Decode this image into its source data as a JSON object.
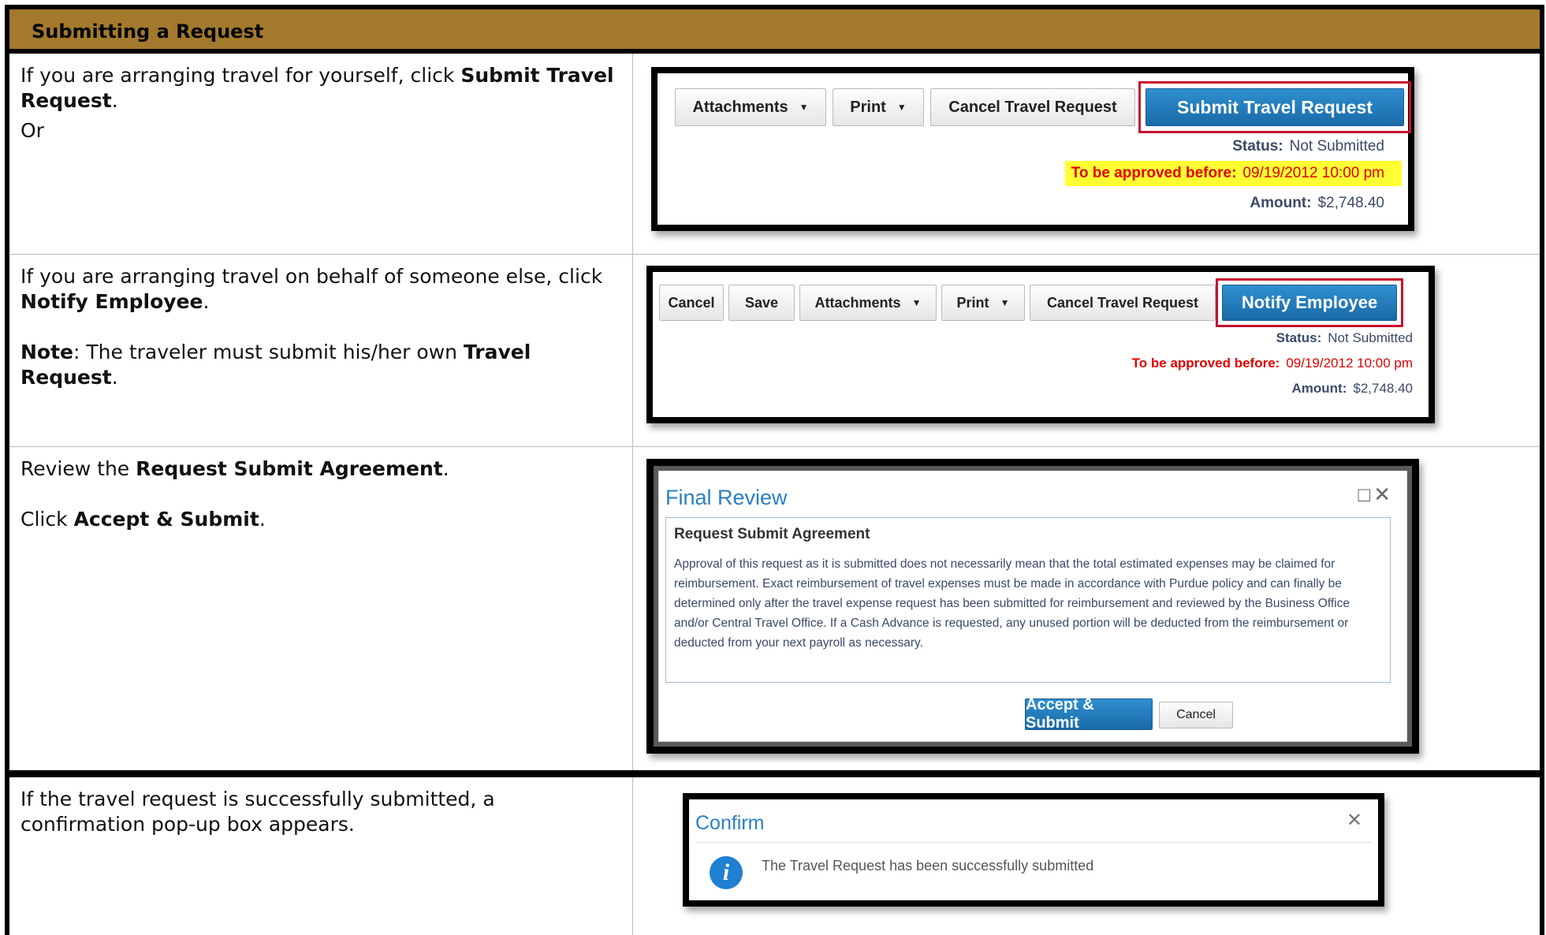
{
  "header": {
    "title": "Submitting a Request"
  },
  "rows": [
    {
      "instr": {
        "p1_pre": "If you are arranging travel for yourself, click ",
        "p1_bold": "Submit Travel Request",
        "p1_post": ".",
        "p2": "Or"
      },
      "shot": {
        "buttons": {
          "attachments": "Attachments",
          "print": "Print",
          "cancel_request": "Cancel Travel Request",
          "submit": "Submit Travel Request"
        },
        "status_label": "Status:",
        "status_value": "Not Submitted",
        "approve_label": "To be approved before:",
        "approve_value": "09/19/2012 10:00 pm",
        "amount_label": "Amount:",
        "amount_value": "$2,748.40"
      }
    },
    {
      "instr": {
        "p1_pre": "If you are arranging travel on behalf of someone else, click ",
        "p1_bold": "Notify Employee",
        "p1_post": ".",
        "note_label": "Note",
        "note_pre": ": The traveler must submit his/her own ",
        "note_bold": "Travel Request",
        "note_post": "."
      },
      "shot": {
        "buttons": {
          "cancel": "Cancel",
          "save": "Save",
          "attachments": "Attachments",
          "print": "Print",
          "cancel_request": "Cancel Travel Request",
          "notify": "Notify Employee"
        },
        "status_label": "Status:",
        "status_value": "Not Submitted",
        "approve_label": "To be approved before:",
        "approve_value": "09/19/2012 10:00 pm",
        "amount_label": "Amount:",
        "amount_value": "$2,748.40"
      }
    },
    {
      "instr": {
        "p1_pre": "Review the ",
        "p1_bold": "Request Submit Agreement",
        "p1_post": ".",
        "p2_pre": "Click ",
        "p2_bold": "Accept & Submit",
        "p2_post": "."
      },
      "shot": {
        "title": "Final Review",
        "agreement_heading": "Request Submit Agreement",
        "agreement_text": "Approval of this request as it is submitted does not necessarily mean that the total estimated expenses may be claimed for reimbursement. Exact reimbursement of travel expenses must be made in accordance with Purdue policy and can finally be determined only after the travel expense request has been submitted for reimbursement and reviewed by the Business Office and/or Central Travel Office. If a Cash Advance is requested, any unused portion will be deducted from the reimbursement or deducted from your next payroll as necessary.",
        "accept_label": "Accept & Submit",
        "cancel_label": "Cancel"
      }
    },
    {
      "instr": {
        "p1": "If the travel request is successfully submitted, a confirmation pop-up box appears."
      },
      "shot": {
        "title": "Confirm",
        "message": "The Travel Request has been successfully submitted"
      }
    }
  ]
}
